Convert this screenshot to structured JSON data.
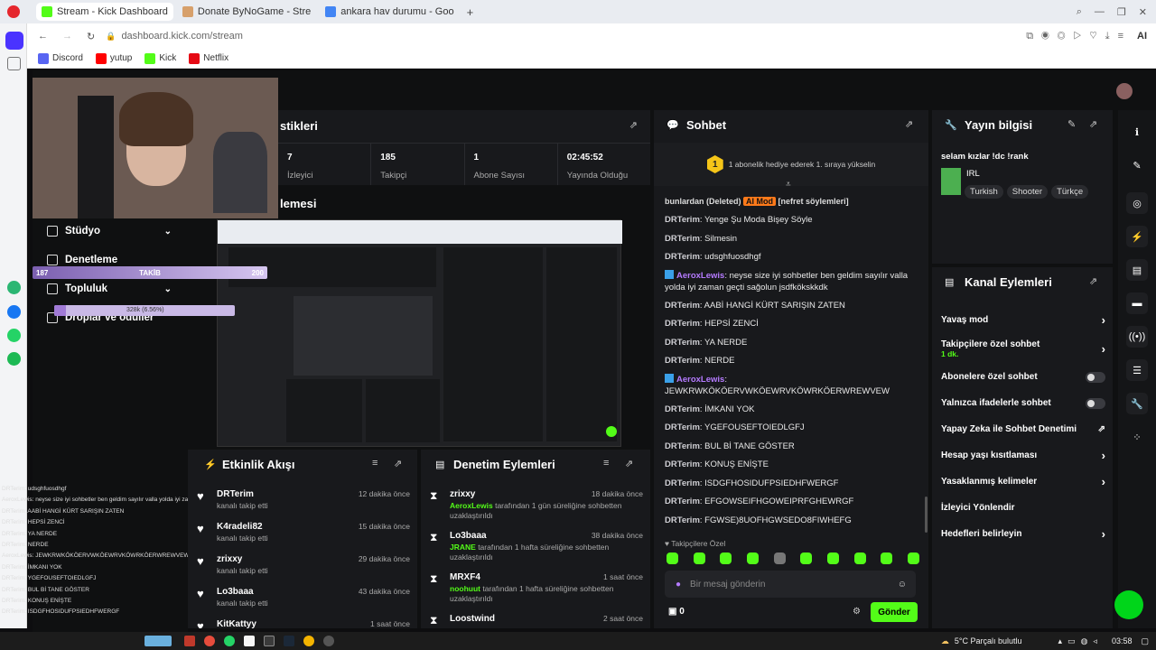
{
  "browser": {
    "tabs": [
      {
        "label": "Stream - Kick Dashboard",
        "active": true,
        "color": "#53fc18"
      },
      {
        "label": "Donate ByNoGame - Stre",
        "active": false,
        "color": "#d7a06b"
      },
      {
        "label": "ankara hav durumu - Goo",
        "active": false,
        "color": "#4285f4"
      }
    ],
    "new_tab": "+",
    "url": "dashboard.kick.com/stream",
    "bookmarks": [
      "Discord",
      "yutup",
      "Kick",
      "Netflix"
    ],
    "ai_label": "AI"
  },
  "overlay": {
    "follow_start": "187",
    "follow_label": "TAKİB",
    "follow_goal": "200",
    "progress_text": "328k (6.56%)",
    "progress_fraction": 0.0656,
    "chat_log": [
      "DRTerim: udsghfuosdhgf",
      "AeroxLewis: neyse size iyi sohbetler ben geldim sayılır valla yolda iyi zaman geçti sağolun jsdfkökskkdk",
      "DRTerim: AABİ HANGİ KÜRT SARIŞIN ZATEN",
      "DRTerim: HEPSİ ZENCİ",
      "DRTerim: YA NERDE",
      "DRTerim: NERDE",
      "AeroxLewis: JEWKRWKÖKÖERVWKÖEWRVKÖWRKÖERWREWVEW",
      "DRTerim: İMKANI YOK",
      "DRTerim: YGEFOUSEFTOIEDLGFJ",
      "DRTerim: BUL Bİ TANE GÖSTER",
      "DRTerim: KONUŞ ENİŞTE",
      "DRTerim: ISDGFHOSIDUFPSIEDHFWERGF"
    ]
  },
  "sidebar": {
    "items": [
      {
        "label": "Stüdyo",
        "chevron": true
      },
      {
        "label": "Denetleme",
        "chevron": false
      },
      {
        "label": "Topluluk",
        "chevron": true
      },
      {
        "label": "Droplar ve ödüller",
        "chevron": false
      }
    ]
  },
  "stats": {
    "title": "stikleri",
    "items": [
      {
        "value": "7",
        "label": "İzleyici"
      },
      {
        "value": "185",
        "label": "Takipçi"
      },
      {
        "value": "1",
        "label": "Abone Sayısı"
      },
      {
        "value": "02:45:52",
        "label": "Yayında Olduğu"
      }
    ]
  },
  "preview": {
    "title": "lemesi"
  },
  "activity": {
    "title": "Etkinlik Akışı",
    "items": [
      {
        "name": "DRTerim",
        "action": "kanalı takip etti",
        "time": "12 dakika önce"
      },
      {
        "name": "K4radeli82",
        "action": "kanalı takip etti",
        "time": "15 dakika önce"
      },
      {
        "name": "zrixxy",
        "action": "kanalı takip etti",
        "time": "29 dakika önce"
      },
      {
        "name": "Lo3baaa",
        "action": "kanalı takip etti",
        "time": "43 dakika önce"
      },
      {
        "name": "KitKattyy",
        "action": "",
        "time": "1 saat önce"
      }
    ]
  },
  "modlog": {
    "title": "Denetim Eylemleri",
    "items": [
      {
        "name": "zrixxy",
        "time": "18 dakika önce",
        "mod": "AeroxLewis",
        "text": "tarafından 1 gün süreliğine sohbetten uzaklaştırıldı"
      },
      {
        "name": "Lo3baaa",
        "time": "38 dakika önce",
        "mod": "JRANE",
        "text": "tarafından 1 hafta süreliğine sohbetten uzaklaştırıldı"
      },
      {
        "name": "MRXF4",
        "time": "1 saat önce",
        "mod": "noohuut",
        "text": "tarafından 1 hafta süreliğine sohbetten uzaklaştırıldı"
      },
      {
        "name": "Loostwind",
        "time": "2 saat önce",
        "mod": "",
        "text": ""
      }
    ]
  },
  "chat": {
    "title": "Sohbet",
    "pinned_rank": "1",
    "pinned_text": "1 abonelik hediye ederek 1. sıraya yükselin",
    "partial_line": "bunlardan (Deleted)",
    "partial_badge": "AI Mod",
    "partial_tail": "[nefret söylemleri]",
    "messages": [
      {
        "user": "DRTerim",
        "text": "Yenge Şu Moda Bişey Söyle"
      },
      {
        "user": "DRTerim",
        "text": "Silmesin"
      },
      {
        "user": "DRTerim",
        "text": "udsghfuosdhgf"
      },
      {
        "user": "AeroxLewis",
        "text": "neyse size iyi sohbetler ben geldim sayılır valla yolda iyi zaman geçti sağolun jsdfkökskkdk"
      },
      {
        "user": "DRTerim",
        "text": "AABİ HANGİ KÜRT SARIŞIN ZATEN"
      },
      {
        "user": "DRTerim",
        "text": "HEPSİ ZENCİ"
      },
      {
        "user": "DRTerim",
        "text": "YA NERDE"
      },
      {
        "user": "DRTerim",
        "text": "NERDE"
      },
      {
        "user": "AeroxLewis",
        "text": "JEWKRWKÖKÖERVWKÖEWRVKÖWRKÖERWREWVEW"
      },
      {
        "user": "DRTerim",
        "text": "İMKANI YOK"
      },
      {
        "user": "DRTerim",
        "text": "YGEFOUSEFTOIEDLGFJ"
      },
      {
        "user": "DRTerim",
        "text": "BUL Bİ TANE GÖSTER"
      },
      {
        "user": "DRTerim",
        "text": "KONUŞ ENİŞTE"
      },
      {
        "user": "DRTerim",
        "text": "ISDGFHOSIDUFPSIEDHFWERGF"
      },
      {
        "user": "DRTerim",
        "text": "EFGOWSEIFHGOWEIPRFGHEWRGF"
      },
      {
        "user": "DRTerim",
        "text": "FGWSE)8UOFHGWSEDO8FIWHEFG"
      }
    ],
    "emote_label": "Takipçilere Özel",
    "placeholder": "Bir mesaj gönderin",
    "points": "0",
    "send": "Gönder"
  },
  "stream_info": {
    "title": "Yayın bilgisi",
    "stream_title": "selam kızlar !dc !rank",
    "category": "IRL",
    "tags": [
      "Turkish",
      "Shooter",
      "Türkçe"
    ]
  },
  "channel_actions": {
    "title": "Kanal Eylemleri",
    "items": [
      {
        "label": "Yavaş mod",
        "control": "chevron"
      },
      {
        "label": "Takipçilere özel sohbet",
        "sub": "1 dk.",
        "control": "chevron"
      },
      {
        "label": "Abonelere özel sohbet",
        "control": "toggle"
      },
      {
        "label": "Yalnızca ifadelerle sohbet",
        "control": "toggle"
      },
      {
        "label": "Yapay Zeka ile Sohbet Denetimi",
        "control": "external"
      },
      {
        "label": "Hesap yaşı kısıtlaması",
        "control": "chevron"
      },
      {
        "label": "Yasaklanmış kelimeler",
        "control": "chevron"
      },
      {
        "label": "İzleyici Yönlendir",
        "control": "none"
      },
      {
        "label": "Hedefleri belirleyin",
        "control": "chevron"
      }
    ]
  },
  "taskbar": {
    "weather": "5°C  Parçalı bulutlu",
    "time": "03:58"
  },
  "colors": {
    "accent": "#53fc18",
    "mod_user": "#b57bff",
    "panel": "#18191c"
  }
}
